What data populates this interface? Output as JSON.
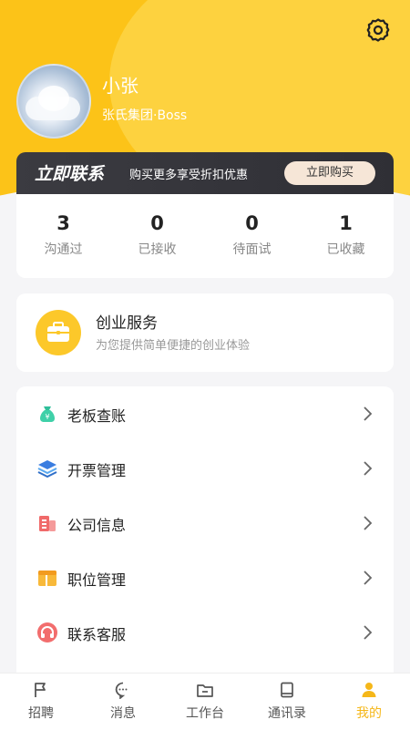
{
  "profile": {
    "name": "小张",
    "company": "张氏集团·Boss"
  },
  "promo": {
    "title": "立即联系",
    "subtitle": "购买更多享受折扣优惠",
    "button_label": "立即购买"
  },
  "stats": [
    {
      "value": "3",
      "label": "沟通过"
    },
    {
      "value": "0",
      "label": "已接收"
    },
    {
      "value": "0",
      "label": "待面试"
    },
    {
      "value": "1",
      "label": "已收藏"
    }
  ],
  "service": {
    "title": "创业服务",
    "subtitle": "为您提供简单便捷的创业体验",
    "icon": "briefcase-icon"
  },
  "menu": [
    {
      "label": "老板查账",
      "icon": "money-bag-icon"
    },
    {
      "label": "开票管理",
      "icon": "layers-icon"
    },
    {
      "label": "公司信息",
      "icon": "building-icon"
    },
    {
      "label": "职位管理",
      "icon": "table-icon"
    },
    {
      "label": "联系客服",
      "icon": "headset-icon"
    }
  ],
  "tabs": [
    {
      "label": "招聘",
      "icon": "flag-icon"
    },
    {
      "label": "消息",
      "icon": "chat-icon"
    },
    {
      "label": "工作台",
      "icon": "folder-icon"
    },
    {
      "label": "通讯录",
      "icon": "book-icon"
    },
    {
      "label": "我的",
      "icon": "user-icon",
      "active": true
    }
  ],
  "colors": {
    "header": "#fcc318",
    "accent": "#f5b719",
    "promo_bg": "#35353b",
    "promo_button": "#f6e6d7"
  }
}
